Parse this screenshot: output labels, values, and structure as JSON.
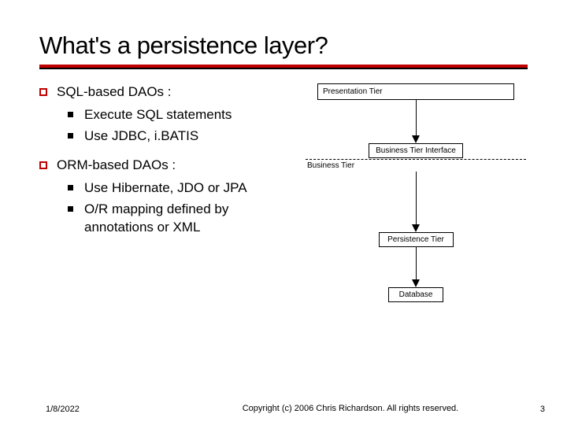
{
  "title": "What's a persistence layer?",
  "bullets": {
    "top1": "SQL-based  DAOs :",
    "top1_subs": [
      "Execute SQL statements",
      "Use JDBC,  i.BATIS"
    ],
    "top2": "ORM-based DAOs :",
    "top2_subs": [
      "Use Hibernate, JDO or JPA",
      "O/R mapping defined by annotations or XML"
    ]
  },
  "diagram": {
    "presentation": "Presentation Tier",
    "bti": "Business Tier Interface",
    "bt": "Business Tier",
    "persist": "Persistence Tier",
    "db": "Database"
  },
  "footer": {
    "date": "1/8/2022",
    "copyright": "Copyright (c)  2006 Chris Richardson. All rights reserved.",
    "page": "3"
  }
}
